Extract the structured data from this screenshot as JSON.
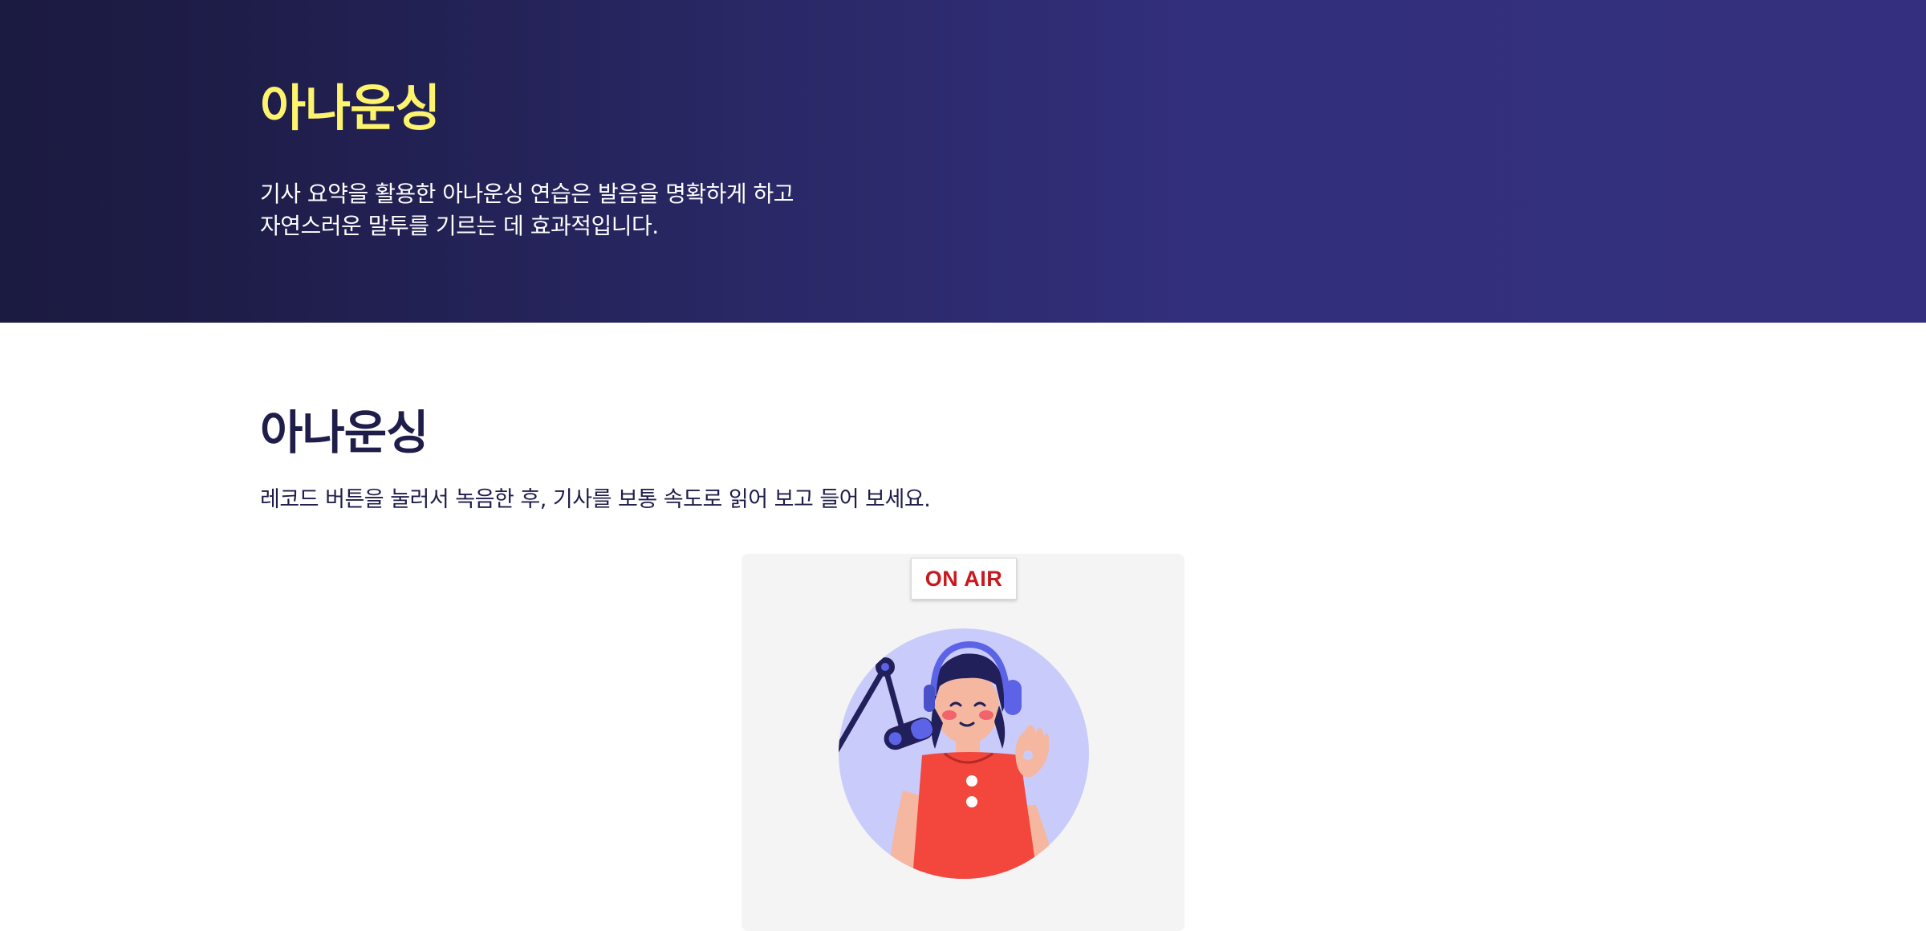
{
  "hero": {
    "title": "아나운싱",
    "description": "기사 요약을 활용한 아나운싱 연습은 발음을 명확하게 하고\n자연스러운 말투를 기르는 데 효과적입니다."
  },
  "section": {
    "title": "아나운싱",
    "instruction": "레코드 버튼을 눌러서 녹음한 후, 기사를 보통 속도로 읽어 보고 들어 보세요."
  },
  "onair": {
    "label": "ON AIR"
  },
  "illustration": {
    "icon": "announcer-with-microphone-icon"
  },
  "colors": {
    "hero_title": "#fdf36d",
    "hero_bg_start": "#1b1a40",
    "hero_bg_end": "#34307f",
    "section_text": "#1f1d4a",
    "onair_red": "#c8191f",
    "card_bg": "#f4f4f4"
  }
}
